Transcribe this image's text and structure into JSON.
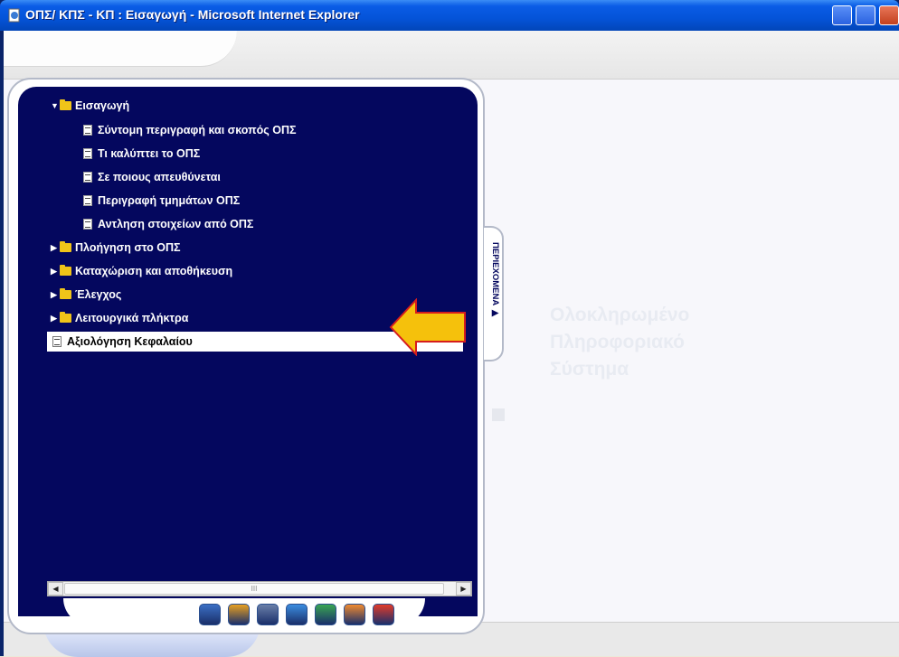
{
  "window": {
    "title": "ΟΠΣ/ ΚΠΣ - ΚΠ : Εισαγωγή - Microsoft Internet Explorer",
    "icon": "ie-page-icon"
  },
  "tree": {
    "items": [
      {
        "label": "Εισαγωγή",
        "type": "folder-open",
        "expanded": true
      },
      {
        "label": "Σύντομη περιγραφή και σκοπός ΟΠΣ",
        "type": "doc"
      },
      {
        "label": "Τι καλύπτει το ΟΠΣ",
        "type": "doc"
      },
      {
        "label": "Σε ποιους απευθύνεται",
        "type": "doc"
      },
      {
        "label": "Περιγραφή τμημάτων ΟΠΣ",
        "type": "doc"
      },
      {
        "label": "Αντληση στοιχείων από ΟΠΣ",
        "type": "doc"
      },
      {
        "label": "Πλοήγηση στο ΟΠΣ",
        "type": "folder"
      },
      {
        "label": "Καταχώριση και αποθήκευση",
        "type": "folder"
      },
      {
        "label": "Έλεγχος",
        "type": "folder"
      },
      {
        "label": "Λειτουργικά πλήκτρα",
        "type": "folder"
      },
      {
        "label": "Αξιολόγηση Κεφαλαίου",
        "type": "doc",
        "selected": true
      }
    ]
  },
  "sidetab": {
    "label": "ΠΕΡΙΕΧΟΜΕΝΑ ▶"
  },
  "watermark": {
    "lines": [
      "Ολοκληρωμένο",
      "Πληροφοριακό",
      "Σύστημα"
    ]
  },
  "scrollbar": {
    "thumb_grip": "III"
  },
  "toolbar": {
    "tools": [
      {
        "name": "home-icon",
        "color": "#3b6fc4"
      },
      {
        "name": "glossary-icon",
        "color": "#e8a020"
      },
      {
        "name": "cube-icon",
        "color": "#6a7fa8"
      },
      {
        "name": "search-icon",
        "color": "#3b8de0"
      },
      {
        "name": "exercise-icon",
        "color": "#3aa652"
      },
      {
        "name": "help-icon",
        "color": "#f08a30"
      },
      {
        "name": "exit-icon",
        "color": "#e23b2a"
      }
    ]
  },
  "colors": {
    "panel": "#04075e",
    "arrow": "#f5c10c",
    "arrow_border": "#d61d1d"
  }
}
